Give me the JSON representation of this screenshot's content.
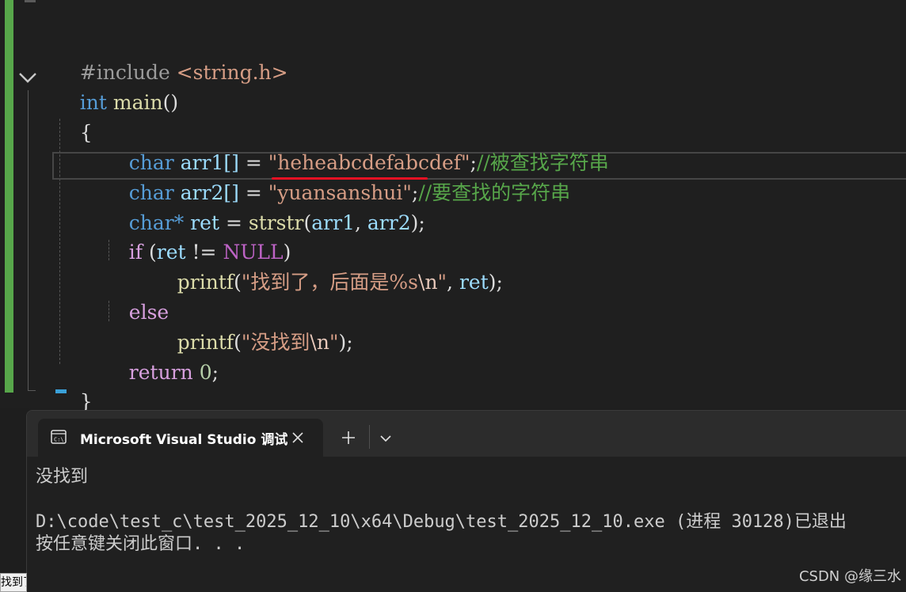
{
  "editor": {
    "lines": {
      "include": {
        "directive": "#include",
        "header": "<string.h>"
      },
      "main_decl": {
        "type": "int",
        "name": "main",
        "parens": "()"
      },
      "open_brace": "{",
      "arr1": {
        "type": "char",
        "name": "arr1[]",
        "op": " = ",
        "value": "\"heheabcdefabcdef\"",
        "semi": ";",
        "comment": "//被查找字符串"
      },
      "arr2": {
        "type": "char",
        "name": "arr2[]",
        "op": " = ",
        "value": "\"yuansanshui\"",
        "semi": ";",
        "comment": "//要查找的字符串"
      },
      "ret": {
        "type": "char*",
        "name": " ret",
        "op": " = ",
        "fn": "strstr",
        "open": "(",
        "a1": "arr1",
        "comma": ", ",
        "a2": "arr2",
        "close": ");"
      },
      "if_stmt": {
        "kw": "if",
        "open": " (",
        "var": "ret",
        "op": " != ",
        "macro": "NULL",
        "close": ")"
      },
      "printf1": {
        "fn": "printf",
        "open": "(",
        "str": "\"找到了，后面是%s",
        "esc": "\\n",
        "strend": "\"",
        "comma": ", ",
        "var": "ret",
        "close": ");"
      },
      "else_stmt": "else",
      "printf2": {
        "fn": "printf",
        "open": "(",
        "str": "\"没找到",
        "esc": "\\n",
        "strend": "\"",
        "close": ");"
      },
      "return_stmt": {
        "kw": "return",
        "num": "0",
        "semi": ";"
      },
      "close_brace": "}"
    }
  },
  "console": {
    "tab_title": "Microsoft Visual Studio 调试控制台",
    "output": "没找到",
    "exit_line": "D:\\code\\test_c\\test_2025_12_10\\x64\\Debug\\test_2025_12_10.exe (进程 30128)已退出",
    "prompt_line": "按任意键关闭此窗口. . ."
  },
  "overlay": {
    "tooltip_fragment": "找到了",
    "watermark": "CSDN @缘三水"
  },
  "icons": {
    "fold": "chevron-down-icon",
    "console": "console-icon",
    "close": "close-icon",
    "add": "plus-icon",
    "dropdown": "chevron-down-icon"
  },
  "colors": {
    "keyword": "#569cd6",
    "control": "#d8a0df",
    "string": "#d69d85",
    "comment": "#57a64a",
    "function": "#dcdcaa",
    "identifier": "#9cdcfe",
    "macro": "#bd63c5",
    "error_squiggle": "#e81123"
  }
}
